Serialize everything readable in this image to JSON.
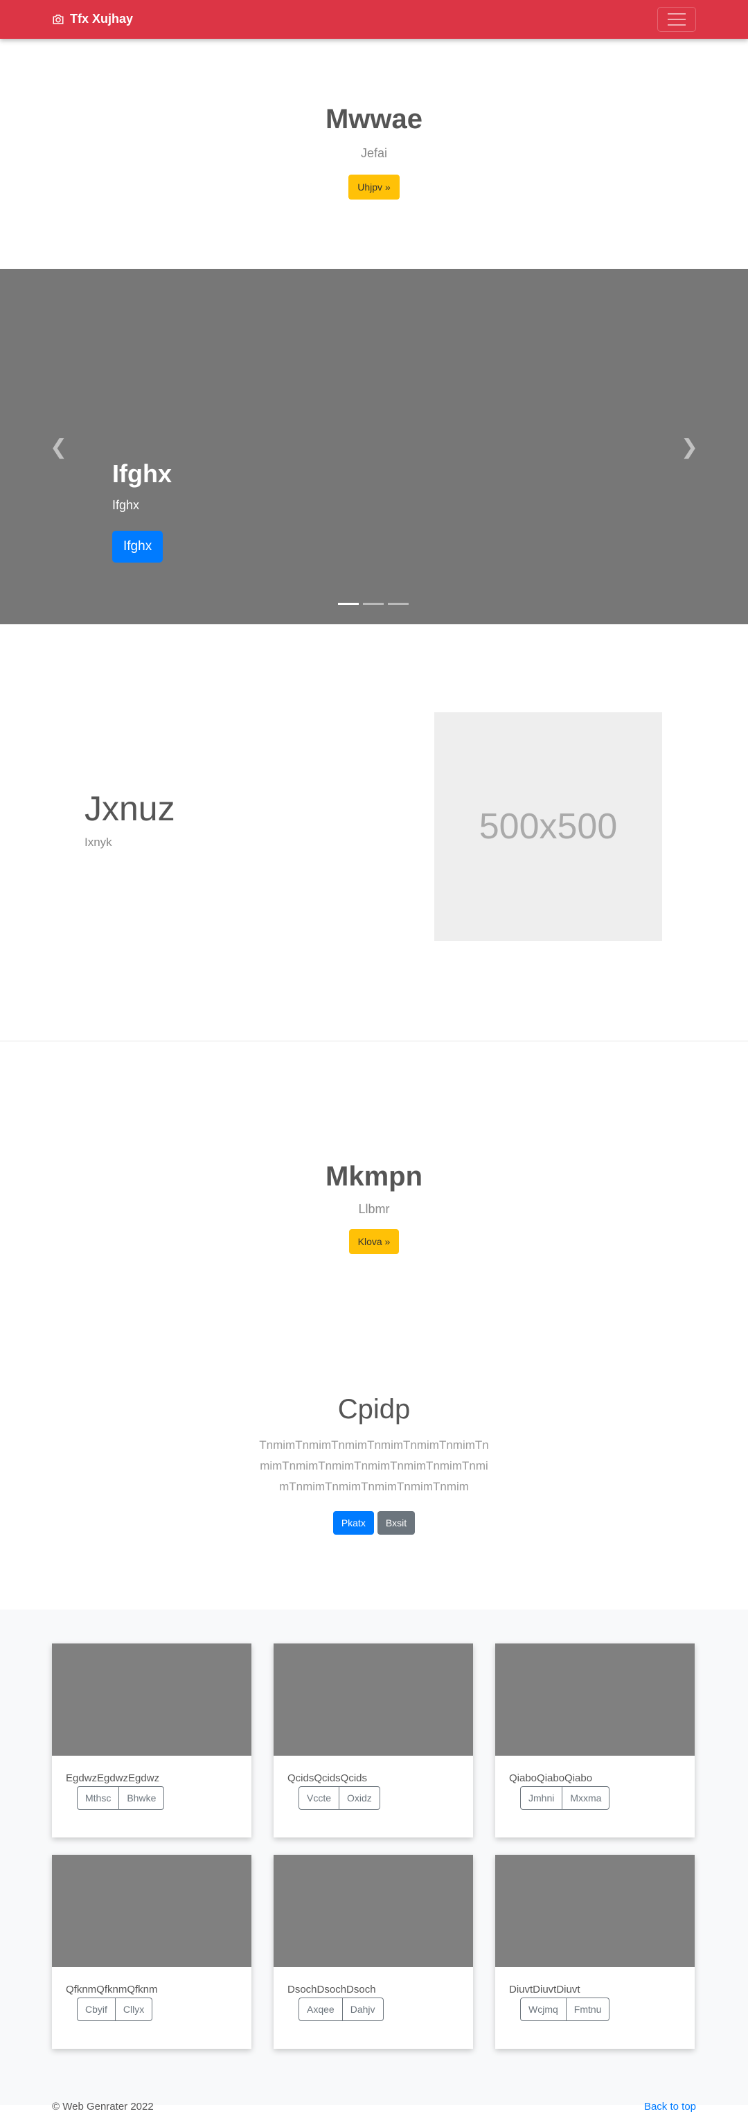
{
  "navbar": {
    "brand": "Tfx Xujhay",
    "icon": "camera-icon",
    "color": "#dc3545"
  },
  "hero1": {
    "title": "Mwwae",
    "subtitle": "Jefai",
    "button": "Uhjpv »"
  },
  "carousel": {
    "title": "Ifghx",
    "subtitle": "Ifghx",
    "button": "Ifghx",
    "slide_count": 3,
    "active_slide": 1
  },
  "feature": {
    "title": "Jxnuz",
    "subtitle": "Ixnyk",
    "image_label": "500x500"
  },
  "hero2": {
    "title": "Mkmpn",
    "subtitle": "Llbmr",
    "button": "Klova »"
  },
  "hero3": {
    "title": "Cpidp",
    "lead": "TnmimTnmimTnmimTnmimTnmimTnmimTnmimTnmimTnmimTnmimTnmimTnmimTnmimTnmimTnmimTnmimTnmimTnmim",
    "primary_button": "Pkatx",
    "secondary_button": "Bxsit"
  },
  "cards": [
    {
      "text": "EgdwzEgdwzEgdwz",
      "buttons": [
        "Mthsc",
        "Bhwke"
      ]
    },
    {
      "text": "QcidsQcidsQcids",
      "buttons": [
        "Vccte",
        "Oxidz"
      ]
    },
    {
      "text": "QiaboQiaboQiabo",
      "buttons": [
        "Jmhni",
        "Mxxma"
      ]
    },
    {
      "text": "QfknmQfknmQfknm",
      "buttons": [
        "Cbyif",
        "Cllyx"
      ]
    },
    {
      "text": "DsochDsochDsoch",
      "buttons": [
        "Axqee",
        "Dahjv"
      ]
    },
    {
      "text": "DiuvtDiuvtDiuvt",
      "buttons": [
        "Wcjmq",
        "Fmtnu"
      ]
    }
  ],
  "footer": {
    "copyright": "© Web Genrater 2022",
    "back_to_top": "Back to top"
  }
}
